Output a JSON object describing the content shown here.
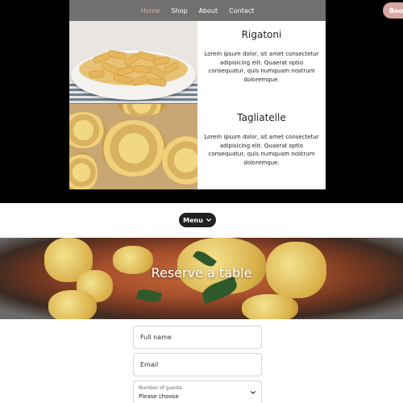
{
  "nav": {
    "links": [
      "Home",
      "Shop",
      "About",
      "Contact"
    ],
    "book_label": "Book"
  },
  "menu_items": [
    {
      "title": "Rigatoni",
      "description": "Lorem ipsum dolor, sit amet consectetur adipisicing elit. Quaerat optio consequatur, quis numquam nostrum doloremque."
    },
    {
      "title": "Tagliatelle",
      "description": "Lorem ipsum dolor, sit amet consectetur adipisicing elit. Quaerat optio consequatur, quis numquam nostrum doloremque."
    }
  ],
  "menu_toggle": {
    "label": "Menu",
    "icon": "chevron-down-icon"
  },
  "hero": {
    "title": "Reserve a table"
  },
  "form": {
    "name_placeholder": "Full name",
    "email_placeholder": "Email",
    "guests_label": "Number of guests",
    "guests_value": "Please choose"
  },
  "colors": {
    "accent": "#d9a8a0",
    "active_nav": "#d9b2aa",
    "dark_bg": "#000000",
    "button_dark": "#222222"
  }
}
